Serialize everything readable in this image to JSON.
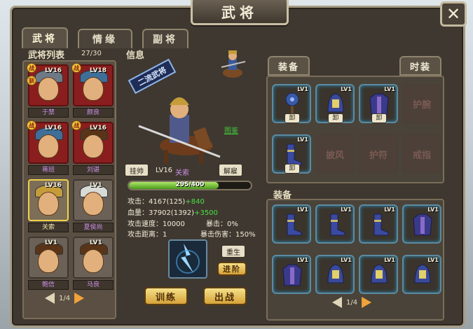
{
  "window": {
    "title": "武将",
    "close": "✕"
  },
  "tabs": [
    "武将",
    "情缘",
    "副将"
  ],
  "roster": {
    "title": "武将列表",
    "count": "27/30",
    "page": "1/4",
    "heroes": [
      {
        "name": "于禁",
        "level": "LV16",
        "badges": [
          "战",
          "驯"
        ],
        "hat": "grey"
      },
      {
        "name": "颜良",
        "level": "LV18",
        "badges": [
          "战"
        ],
        "hat": "blue"
      },
      {
        "name": "蒋班",
        "level": "LV16",
        "badges": [
          "战"
        ],
        "hat": "blue"
      },
      {
        "name": "刘谌",
        "level": "LV16",
        "badges": [
          "战"
        ],
        "hat": "hair"
      },
      {
        "name": "关索",
        "level": "LV16",
        "badges": [],
        "hat": "gold"
      },
      {
        "name": "夏侯尚",
        "level": "LV1",
        "badges": [],
        "hat": "white"
      },
      {
        "name": "鲍信",
        "level": "LV1",
        "badges": [],
        "hat": "hair"
      },
      {
        "name": "马良",
        "level": "LV1",
        "badges": [],
        "hat": "hair"
      }
    ]
  },
  "info": {
    "title": "信息",
    "ribbon": "二流武将",
    "codex": "图鉴",
    "hang_btn": "挂帅",
    "level": "LV16",
    "name": "关索",
    "dismiss_btn": "解雇",
    "hp_text": "295/400",
    "hp_ratio": 0.7375,
    "attack": "攻击：4167(125)",
    "attack_bonus": "+840",
    "blood": "血量：37902(1392)",
    "blood_bonus": "+3500",
    "crit": "暴击：0%",
    "atk_speed": "攻击速度：10000",
    "atk_range": "攻击距离：1",
    "crit_dmg": "暴击伤害：150%",
    "rebirth_btn": "重生",
    "advance_btn": "进阶",
    "train_btn": "训练",
    "battle_btn": "出战"
  },
  "equip_top": {
    "tab1": "装备",
    "tab2": "时装",
    "slots": [
      {
        "type": "mace",
        "level": "LV1",
        "action": "卸"
      },
      {
        "type": "helmet",
        "level": "LV1",
        "action": "卸"
      },
      {
        "type": "armor",
        "level": "LV1",
        "action": "卸"
      },
      {
        "type": "empty",
        "label": "护腕"
      },
      {
        "type": "boots",
        "level": "LV1",
        "action": "卸"
      },
      {
        "type": "empty",
        "label": "披风"
      },
      {
        "type": "empty",
        "label": "护符"
      },
      {
        "type": "empty",
        "label": "戒指"
      }
    ]
  },
  "equip_bottom": {
    "title": "装备",
    "page": "1/4",
    "slots": [
      {
        "type": "boots",
        "level": "LV1"
      },
      {
        "type": "boots",
        "level": "LV1"
      },
      {
        "type": "boots",
        "level": "LV1"
      },
      {
        "type": "armor",
        "level": "LV1"
      },
      {
        "type": "armor",
        "level": "LV1"
      },
      {
        "type": "helmet",
        "level": "LV1"
      },
      {
        "type": "helmet",
        "level": "LV1"
      },
      {
        "type": "helmet",
        "level": "LV1"
      }
    ]
  }
}
